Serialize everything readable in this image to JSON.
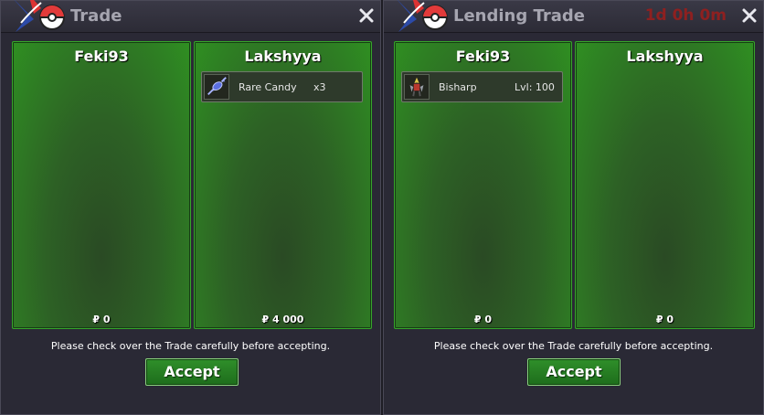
{
  "colors": {
    "panel_green": "#2f8f22",
    "window_bg": "#2a2935",
    "timer_red": "#8e2020",
    "title_gray": "#a6a5b0"
  },
  "trade_window": {
    "title": "Trade",
    "logo_icon": "pokeball-logo-icon",
    "close_icon": "close-icon",
    "left_panel": {
      "name": "Feki93",
      "money": "₽ 0",
      "items": []
    },
    "right_panel": {
      "name": "Lakshyya",
      "money": "₽ 4 000",
      "items": [
        {
          "icon": "rare-candy-icon",
          "name": "Rare Candy",
          "extra": "x3"
        }
      ]
    },
    "notice": "Please check over the Trade carefully before accepting.",
    "accept_label": "Accept"
  },
  "lending_window": {
    "title": "Lending Trade",
    "timer": "1d 0h 0m",
    "logo_icon": "pokeball-logo-icon",
    "close_icon": "close-icon",
    "left_panel": {
      "name": "Feki93",
      "money": "₽ 0",
      "items": [
        {
          "icon": "bisharp-icon",
          "name": "Bisharp",
          "extra": "Lvl: 100"
        }
      ]
    },
    "right_panel": {
      "name": "Lakshyya",
      "money": "₽ 0",
      "items": []
    },
    "notice": "Please check over the Trade carefully before accepting.",
    "accept_label": "Accept"
  }
}
